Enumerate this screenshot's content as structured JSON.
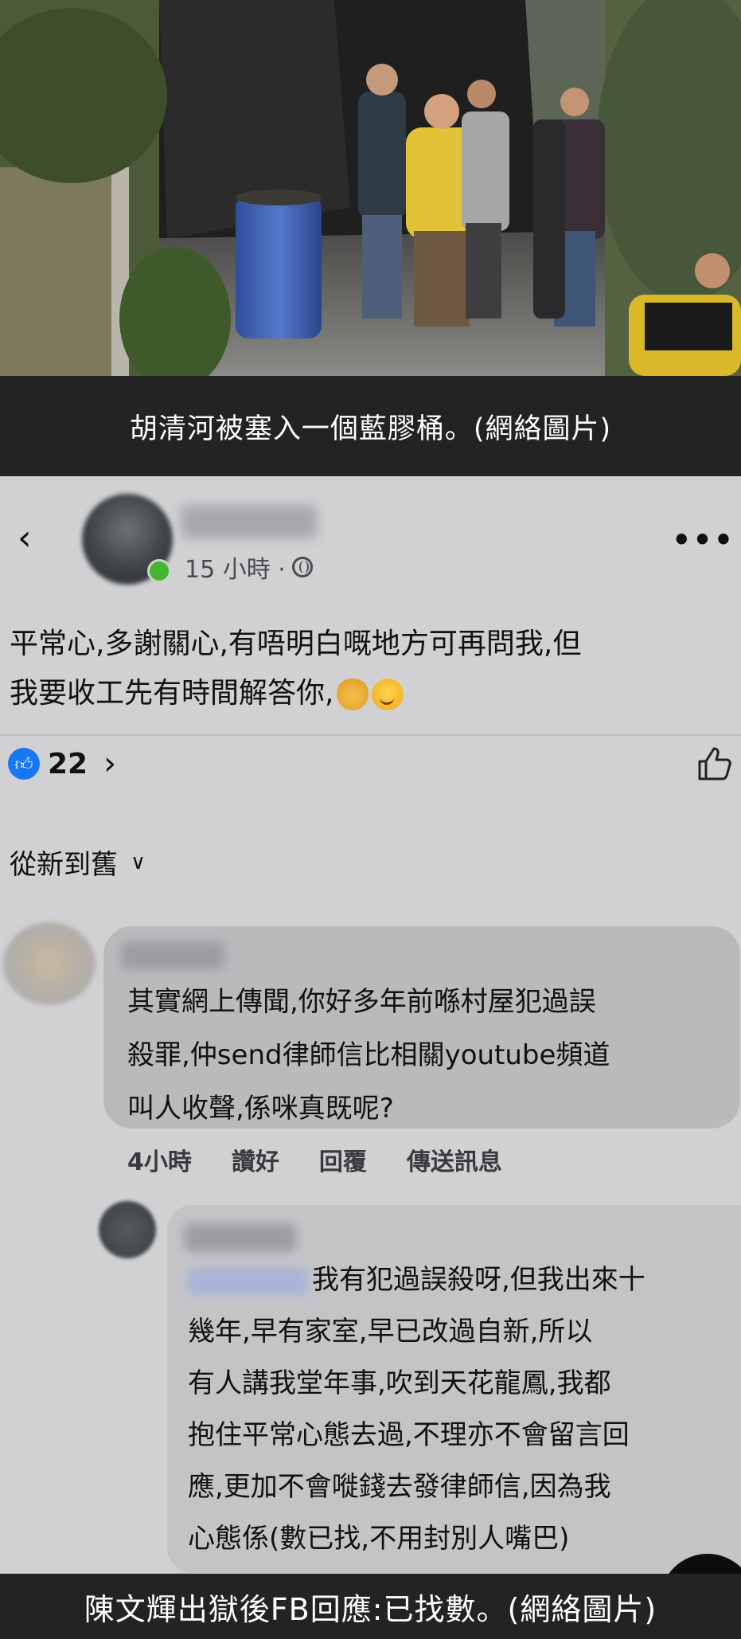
{
  "top_caption": "胡清河被塞入一個藍膠桶。(網絡圖片)",
  "bottom_caption": "陳文輝出獄後FB回應:已找數。(網絡圖片)",
  "post": {
    "time": "15 小時 ·",
    "text_line1": "平常心,多謝關心,有唔明白嘅地方可再問我,但",
    "text_line2": "我要收工先有時間解答你,",
    "like_count": "22"
  },
  "sort_label": "從新到舊",
  "comment1": {
    "line1": "其實網上傳聞,你好多年前喺村屋犯過誤",
    "line2": "殺罪,仲send律師信比相關youtube頻道",
    "line3": "叫人收聲,係咪真既呢?",
    "time": "4小時",
    "action_like": "讚好",
    "action_reply": "回覆",
    "action_message": "傳送訊息"
  },
  "reply": {
    "line1": "我有犯過誤殺呀,但我出來十",
    "line2": "幾年,早有家室,早已改過自新,所以",
    "line3": "有人講我堂年事,吹到天花龍鳳,我都",
    "line4": "抱住平常心態去過,不理亦不會留言回",
    "line5": "應,更加不會嘥錢去發律師信,因為我",
    "line6": "心態係(數已找,不用封別人嘴巴)"
  },
  "colors": {
    "caption_bg": "#232323",
    "fb_bg": "#d1d1d3",
    "comment_bubble": "#bababd",
    "like_blue": "#1877f2",
    "online_green": "#42b72a"
  },
  "icons": [
    "back-arrow-icon",
    "globe-icon",
    "more-dots-icon",
    "like-icon",
    "chevron-right-icon",
    "chevron-down-icon",
    "thumbs-up-icon",
    "chevron-up-icon"
  ]
}
